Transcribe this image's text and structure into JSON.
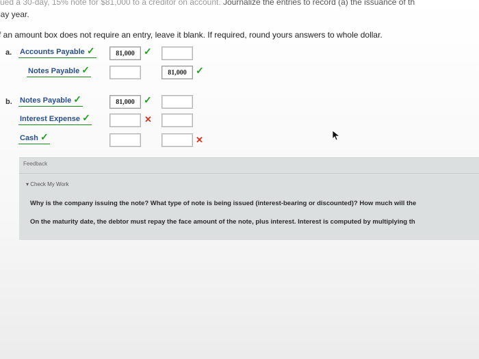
{
  "header": {
    "top_text_faded": "ued a 30-day, 15% note for $81,000 to a creditor on account.",
    "top_text": " Journalize the entries to record (a) the issuance of th",
    "day_year": "lay year.",
    "instructions": "f an amount box does not require an entry, leave it blank. If required, round yours answers to whole dollar."
  },
  "entry_a": {
    "letter": "a.",
    "rows": [
      {
        "account": "Accounts Payable",
        "debit": "81,000",
        "credit": ""
      },
      {
        "account": "Notes Payable",
        "debit": "",
        "credit": "81,000"
      }
    ]
  },
  "entry_b": {
    "letter": "b.",
    "rows": [
      {
        "account": "Notes Payable",
        "debit": "81,000",
        "credit": ""
      },
      {
        "account": "Interest Expense",
        "debit": "",
        "credit": ""
      },
      {
        "account": "Cash",
        "debit": "",
        "credit": ""
      }
    ]
  },
  "marks": {
    "check": "✓",
    "cross": "✕"
  },
  "feedback": {
    "label": "Feedback",
    "check_my_work": "▾ Check My Work",
    "q1": "Why is the company issuing the note? What type of note is being issued (interest-bearing or discounted)? How much will the",
    "q2": "On the maturity date, the debtor must repay the face amount of the note, plus interest. Interest is computed by multiplying th"
  },
  "colors": {
    "check": "#1e9e1e",
    "cross": "#d9301e",
    "feedback_bg": "#dcdfe0"
  }
}
